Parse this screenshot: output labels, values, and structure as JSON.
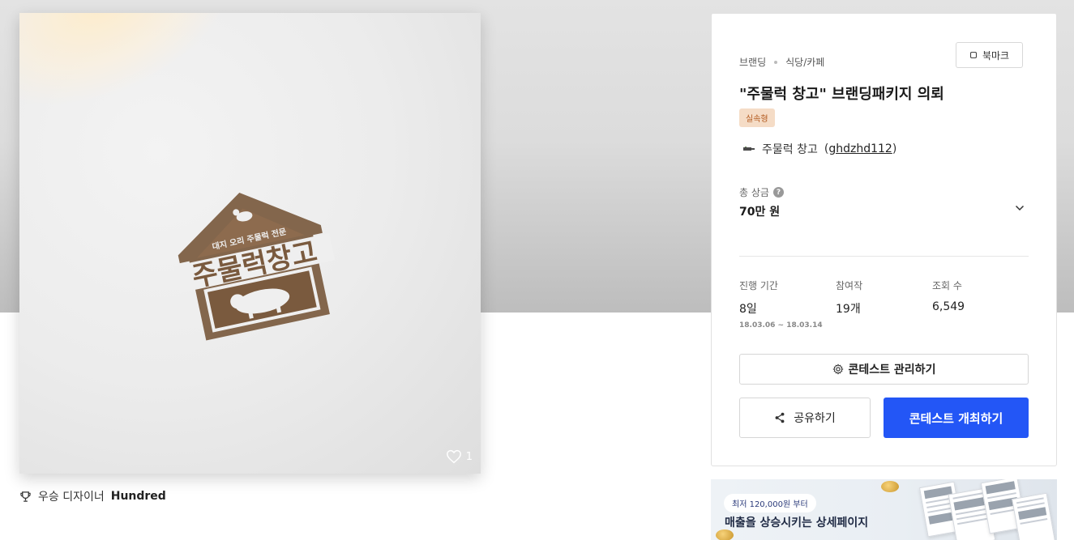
{
  "artwork": {
    "logo_top_text": "대지 오리 주물럭 전문",
    "logo_main_text": "주물럭창고",
    "like_count": "1"
  },
  "winner": {
    "label": "우승 디자이너",
    "name": "Hundred"
  },
  "contest": {
    "category": "브랜딩",
    "subcategory": "식당/카페",
    "bookmark_label": "북마크",
    "title": "\"주물럭 창고\" 브랜딩패키지 의뢰",
    "badge": "실속형",
    "client_name": "주물럭 창고",
    "client_id": "ghdzhd112",
    "prize_label": "총 상금",
    "prize_help": "?",
    "prize_value": "70만 원",
    "stats": [
      {
        "label": "진행 기간",
        "value": "8일",
        "sub": "18.03.06  ~  18.03.14"
      },
      {
        "label": "참여작",
        "value": "19개"
      },
      {
        "label": "조회 수",
        "value": "6,549"
      }
    ],
    "manage_label": "콘테스트 관리하기",
    "share_label": "공유하기",
    "host_label": "콘테스트 개최하기"
  },
  "ad": {
    "price_pill": "최저 120,000원 부터",
    "headline": "매출을 상승시키는 상세페이지"
  },
  "colors": {
    "primary": "#2356f6",
    "badge_bg": "#f5dcc6",
    "badge_text": "#b35a1f",
    "logo_brown": "#7a5a3e"
  }
}
